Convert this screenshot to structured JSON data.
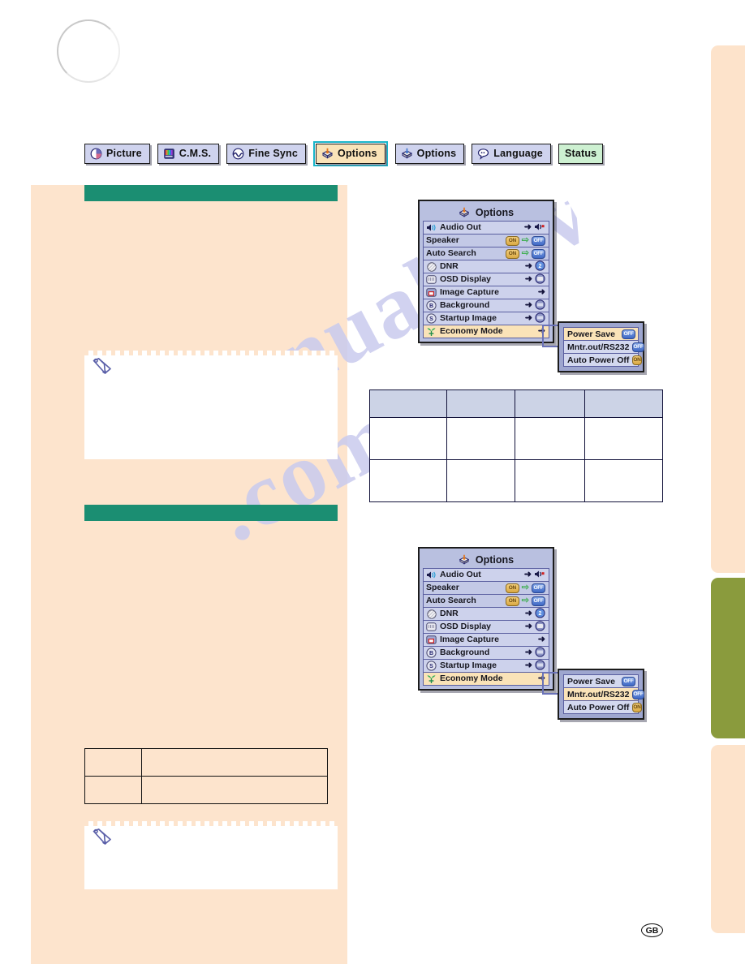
{
  "tabs": [
    {
      "label": "Picture",
      "icon": "picture-icon",
      "selected": false,
      "style": "default"
    },
    {
      "label": "C.M.S.",
      "icon": "cms-icon",
      "selected": false,
      "style": "default"
    },
    {
      "label": "Fine Sync",
      "icon": "fine-sync-icon",
      "selected": false,
      "style": "default"
    },
    {
      "label": "Options",
      "icon": "options1-icon",
      "selected": true,
      "style": "selected"
    },
    {
      "label": "Options",
      "icon": "options2-icon",
      "selected": false,
      "style": "default"
    },
    {
      "label": "Language",
      "icon": "language-icon",
      "selected": false,
      "style": "default"
    },
    {
      "label": "Status",
      "icon": "",
      "selected": false,
      "style": "status"
    }
  ],
  "colors": {
    "header_green": "#1b8e72",
    "page_peach": "#fde4cd",
    "tab_selected_fill": "#fae3b8",
    "tab_default_fill": "#cfd3ee",
    "status_fill": "#cdf0d1",
    "selection_outline": "#19b5c9",
    "edge_tab_active": "#8a9b3d",
    "osd_panel": "#b9c0e0",
    "osd_row": "#cdd2ec",
    "table_header": "#ccd3e6",
    "watermark": "#c9cbee"
  },
  "osd_menu": {
    "title": "Options",
    "title_icon": "options1-icon",
    "rows": [
      {
        "label": "Audio Out",
        "icon": "audio-out-icon",
        "left_pill": null,
        "right_arrow": "→",
        "right_icon": "speaker-mute-icon",
        "highlight": false
      },
      {
        "label": "Speaker",
        "icon": null,
        "left_pill": "ON",
        "right_arrow": "⇨",
        "right_pill": "OFF",
        "highlight": false
      },
      {
        "label": "Auto Search",
        "icon": null,
        "left_pill": "ON",
        "right_arrow": "⇨",
        "right_pill": "OFF",
        "highlight": false
      },
      {
        "label": "DNR",
        "icon": "dnr-icon",
        "right_arrow": "→",
        "right_icon": "dnr-value-icon",
        "highlight": false
      },
      {
        "label": "OSD Display",
        "icon": "osd-display-icon",
        "right_arrow": "→",
        "right_icon": "osd-value-icon",
        "highlight": false
      },
      {
        "label": "Image Capture",
        "icon": "image-capture-icon",
        "right_arrow": "→",
        "right_icon": null,
        "highlight": false
      },
      {
        "label": "Background",
        "icon": "background-icon",
        "right_arrow": "→",
        "right_icon": "background-value-icon",
        "highlight": false
      },
      {
        "label": "Startup Image",
        "icon": "startup-image-icon",
        "right_arrow": "→",
        "right_icon": "startup-value-icon",
        "highlight": false
      },
      {
        "label": "Economy Mode",
        "icon": "economy-mode-icon",
        "right_arrow": "→",
        "right_icon": null,
        "highlight": true
      }
    ]
  },
  "popup_top": {
    "rows": [
      {
        "label": "Power Save",
        "value": "OFF",
        "state": "off",
        "highlight": true
      },
      {
        "label": "Mntr.out/RS232",
        "value": "OFF",
        "state": "off",
        "highlight": false
      },
      {
        "label": "Auto Power Off",
        "value": "ON",
        "state": "on",
        "highlight": false
      }
    ]
  },
  "popup_bottom": {
    "rows": [
      {
        "label": "Power Save",
        "value": "OFF",
        "state": "off",
        "highlight": false
      },
      {
        "label": "Mntr.out/RS232",
        "value": "OFF",
        "state": "off",
        "highlight": true
      },
      {
        "label": "Auto Power Off",
        "value": "ON",
        "state": "on",
        "highlight": false
      }
    ]
  },
  "table_right": {
    "header": [
      "",
      "",
      "",
      ""
    ],
    "rows": [
      [
        "",
        "",
        "",
        ""
      ],
      [
        "",
        "",
        "",
        ""
      ]
    ]
  },
  "table_left": {
    "rows": [
      [
        "",
        ""
      ],
      [
        "",
        ""
      ]
    ]
  },
  "notes": [
    {
      "icon": "pencil-note-icon",
      "text": ""
    },
    {
      "icon": "pencil-note-icon",
      "text": ""
    }
  ],
  "sections": [
    {
      "title": ""
    },
    {
      "title": ""
    }
  ],
  "watermark": {
    "line1": "manualshive",
    "line2": ".com"
  },
  "page_number": {
    "label": "GB"
  }
}
